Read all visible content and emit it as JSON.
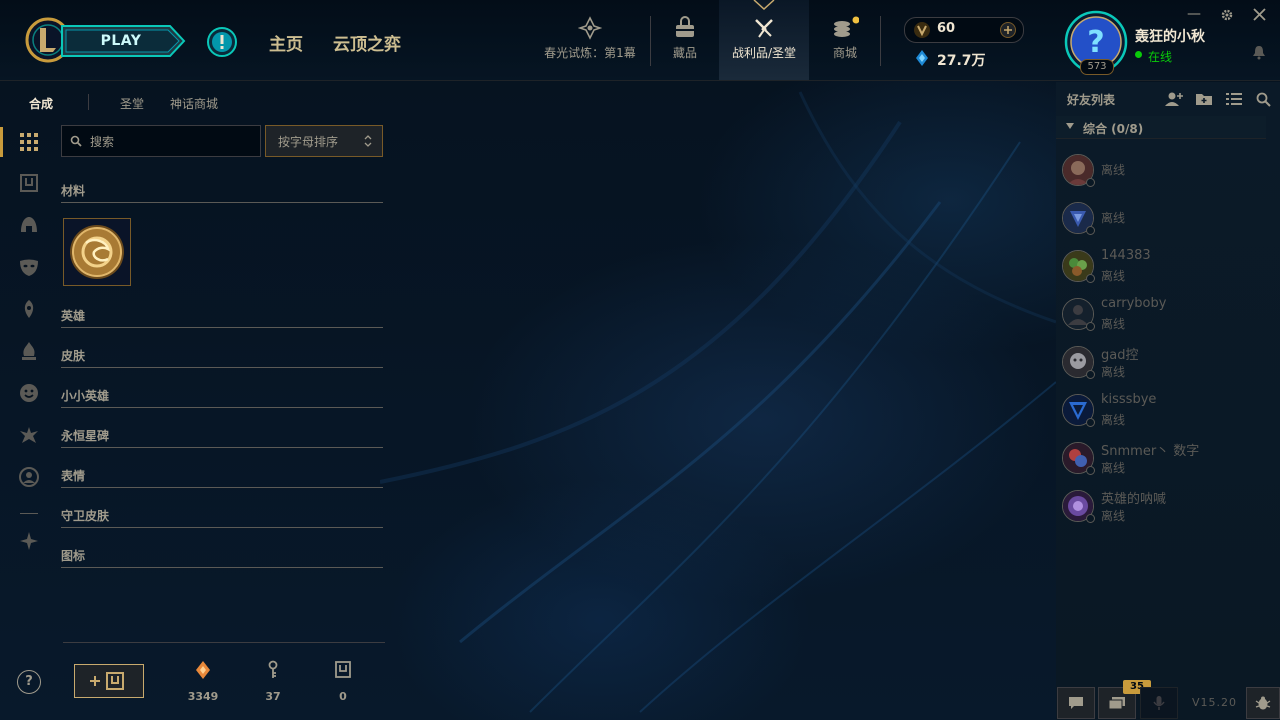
{
  "topbar": {
    "play_label": "PLAY",
    "nav": [
      "主页",
      "云顶之弈"
    ],
    "icons": [
      {
        "label": "春光试炼：第1幕",
        "icon": "trial-icon"
      },
      {
        "label": "藏品",
        "icon": "collection-icon"
      },
      {
        "label": "战利品/圣堂",
        "icon": "loot-icon"
      },
      {
        "label": "商城",
        "icon": "store-icon"
      }
    ],
    "rp": "60",
    "blue_essence": "27.7万",
    "user": {
      "name": "轰狂的小秋",
      "status": "在线",
      "level": "573"
    }
  },
  "subnav": {
    "tabs": [
      "合成",
      "圣堂",
      "神话商城"
    ],
    "active": "合成"
  },
  "crafting": {
    "search_placeholder": "搜索",
    "sort_label": "按字母排序",
    "categories": [
      "材料",
      "英雄",
      "皮肤",
      "小小英雄",
      "永恒星碑",
      "表情",
      "守卫皮肤",
      "图标"
    ]
  },
  "resources": [
    {
      "icon": "orange-essence-icon",
      "value": "3349"
    },
    {
      "icon": "key-icon",
      "value": "37"
    },
    {
      "icon": "chest-icon",
      "value": "0"
    }
  ],
  "help_label": "?",
  "friends": {
    "title": "好友列表",
    "group": "综合 (0/8)",
    "list": [
      {
        "name": "",
        "status": "离线"
      },
      {
        "name": "",
        "status": "离线"
      },
      {
        "name": "144383",
        "status": "离线"
      },
      {
        "name": "carryboby",
        "status": "离线"
      },
      {
        "name": "gad控",
        "status": "离线"
      },
      {
        "name": "kisssbye",
        "status": "离线"
      },
      {
        "name": "Snmmer丶 数字",
        "status": "离线"
      },
      {
        "name": "英雄的呐喊",
        "status": "离线"
      }
    ]
  },
  "bottom": {
    "notification_count": "35",
    "version": "V15.20"
  },
  "colors": {
    "gold": "#c8aa6e",
    "teal": "#0ac8b9",
    "online": "#0acb0a"
  }
}
